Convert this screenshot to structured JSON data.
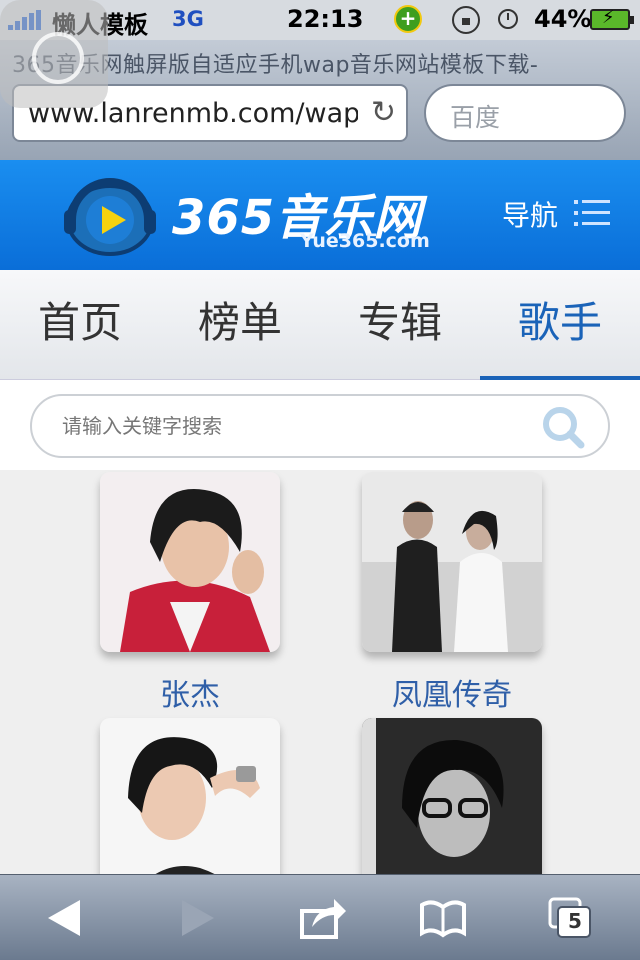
{
  "status_bar": {
    "carrier": "懒人模板",
    "network": "3G",
    "time": "22:13",
    "battery_percent": "44%"
  },
  "browser": {
    "page_title": "365音乐网触屏版自适应手机wap音乐网站模板下载-",
    "url": "www.lanrenmb.com/wap",
    "search_placeholder": "百度",
    "tabs_count": "5"
  },
  "site": {
    "logo_text": "365音乐网",
    "logo_sub": "Yue365.com",
    "nav_label": "导航",
    "brand_color": "#1a8ef0"
  },
  "tabs": [
    {
      "label": "首页",
      "active": false
    },
    {
      "label": "榜单",
      "active": false
    },
    {
      "label": "专辑",
      "active": false
    },
    {
      "label": "歌手",
      "active": true
    }
  ],
  "search": {
    "placeholder": "请输入关键字搜索"
  },
  "singers": [
    {
      "name": "张杰"
    },
    {
      "name": "凤凰传奇"
    },
    {
      "name": ""
    },
    {
      "name": ""
    }
  ]
}
